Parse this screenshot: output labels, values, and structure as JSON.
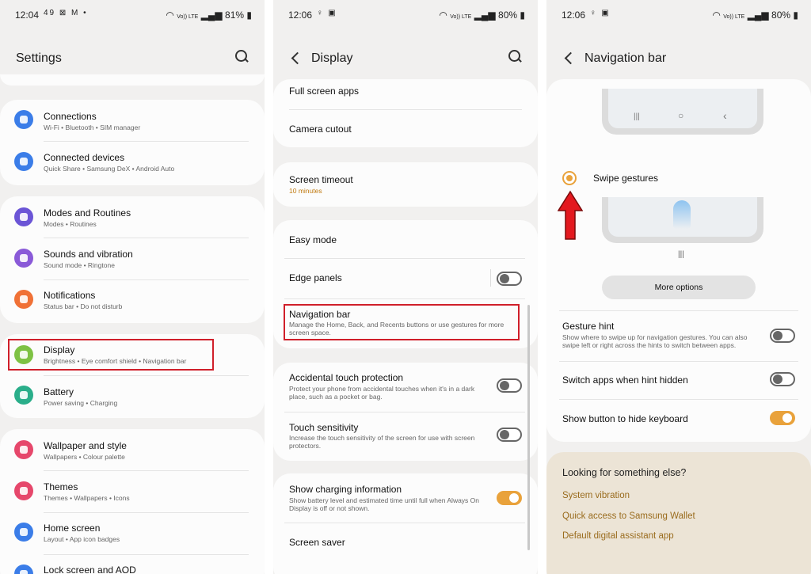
{
  "status_bars": [
    {
      "time": "12:04",
      "left_icons": "49 ⊠ M •",
      "signal": "Vo)) LTE",
      "battery": "81%"
    },
    {
      "time": "12:06",
      "left_icons": "♀ ▣",
      "signal": "Vo)) LTE",
      "battery": "80%"
    },
    {
      "time": "12:06",
      "left_icons": "♀ ▣",
      "signal": "Vo)) LTE",
      "battery": "80%"
    }
  ],
  "settings": {
    "title": "Settings",
    "items": [
      {
        "title": "Connections",
        "subtitle": "Wi-Fi  •  Bluetooth  •  SIM manager",
        "icon": "wifi-icon",
        "color": "#3b7de8"
      },
      {
        "title": "Connected devices",
        "subtitle": "Quick Share  •  Samsung DeX  •  Android Auto",
        "icon": "devices-icon",
        "color": "#3b7de8"
      },
      {
        "title": "Modes and Routines",
        "subtitle": "Modes  •  Routines",
        "icon": "modes-icon",
        "color": "#6b55d6"
      },
      {
        "title": "Sounds and vibration",
        "subtitle": "Sound mode  •  Ringtone",
        "icon": "sound-icon",
        "color": "#8a5ad8"
      },
      {
        "title": "Notifications",
        "subtitle": "Status bar  •  Do not disturb",
        "icon": "notification-icon",
        "color": "#f07136"
      },
      {
        "title": "Display",
        "subtitle": "Brightness  •  Eye comfort shield  •  Navigation bar",
        "icon": "display-icon",
        "color": "#7ec244"
      },
      {
        "title": "Battery",
        "subtitle": "Power saving  •  Charging",
        "icon": "battery-icon",
        "color": "#2aae8a"
      },
      {
        "title": "Wallpaper and style",
        "subtitle": "Wallpapers  •  Colour palette",
        "icon": "wallpaper-icon",
        "color": "#e6476b"
      },
      {
        "title": "Themes",
        "subtitle": "Themes  •  Wallpapers  •  Icons",
        "icon": "themes-icon",
        "color": "#e6476b"
      },
      {
        "title": "Home screen",
        "subtitle": "Layout  •  App icon badges",
        "icon": "home-icon",
        "color": "#3b7de8"
      },
      {
        "title": "Lock screen and AOD",
        "subtitle": "",
        "icon": "lock-icon",
        "color": "#3b7de8"
      }
    ]
  },
  "display": {
    "title": "Display",
    "items": [
      {
        "title": "Full screen apps"
      },
      {
        "title": "Camera cutout"
      },
      {
        "title": "Screen timeout",
        "subtitle": "10 minutes"
      },
      {
        "title": "Easy mode"
      },
      {
        "title": "Edge panels"
      },
      {
        "title": "Navigation bar",
        "subtitle": "Manage the Home, Back, and Recents buttons or use gestures for more screen space."
      },
      {
        "title": "Accidental touch protection",
        "subtitle": "Protect your phone from accidental touches when it's in a dark place, such as a pocket or bag."
      },
      {
        "title": "Touch sensitivity",
        "subtitle": "Increase the touch sensitivity of the screen for use with screen protectors."
      },
      {
        "title": "Show charging information",
        "subtitle": "Show battery level and estimated time until full when Always On Display is off or not shown."
      },
      {
        "title": "Screen saver"
      }
    ]
  },
  "navbar": {
    "title": "Navigation bar",
    "buttons_glyphs": {
      "recents": "|||",
      "home": "○",
      "back": "‹"
    },
    "swipe_label": "Swipe gestures",
    "hint_glyph": "|||",
    "more_options": "More options",
    "gesture_hint_title": "Gesture hint",
    "gesture_hint_sub": "Show where to swipe up for navigation gestures. You can also swipe left or right across the hints to switch between apps.",
    "switch_apps": "Switch apps when hint hidden",
    "show_button": "Show button to hide keyboard",
    "looking_title": "Looking for something else?",
    "links": [
      "System vibration",
      "Quick access to Samsung Wallet",
      "Default digital assistant app"
    ]
  },
  "colors": {
    "accent": "#e9a23b",
    "highlight": "#d01f2a",
    "link": "#9a6c1e"
  }
}
